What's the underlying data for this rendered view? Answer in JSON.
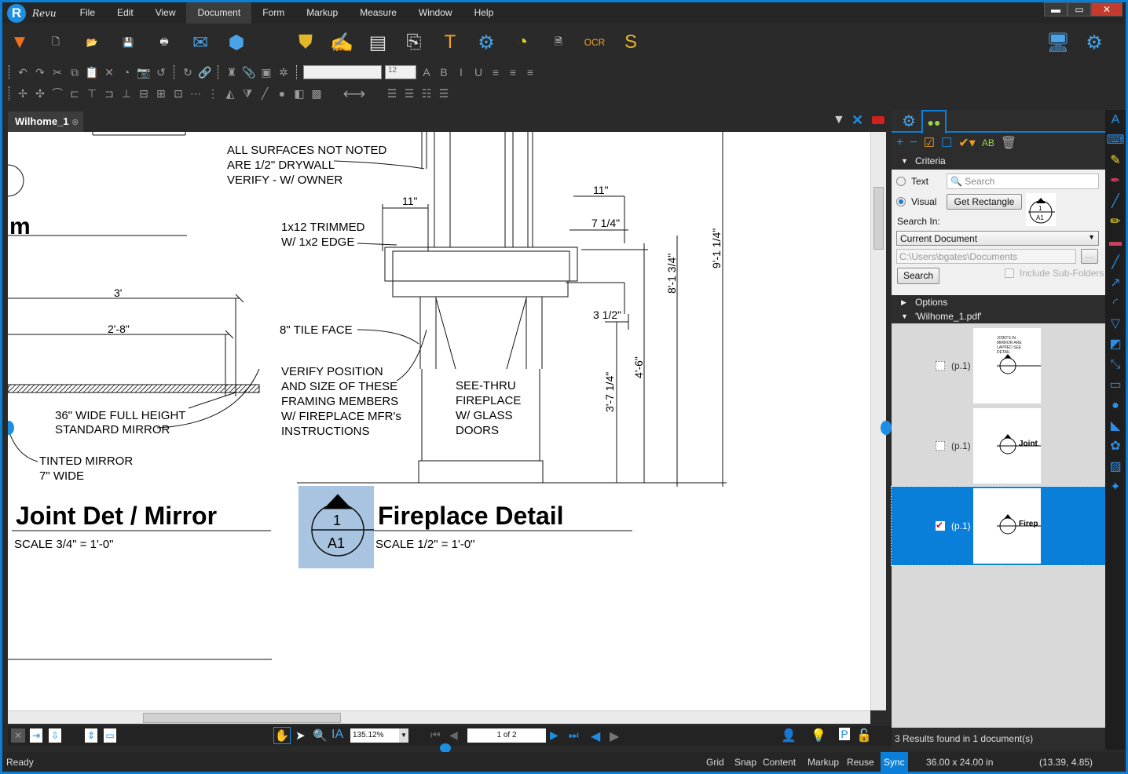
{
  "app": {
    "name": "Revu",
    "logo_letter": "R"
  },
  "menu": [
    "File",
    "Edit",
    "View",
    "Document",
    "Form",
    "Markup",
    "Measure",
    "Window",
    "Help"
  ],
  "menu_active": "Document",
  "window_controls": {
    "minimize": "▬",
    "restore": "▭",
    "close": "✕"
  },
  "toolbar_main": [
    {
      "name": "dropdown-arrow-icon",
      "glyph": "▼",
      "color": "#f07020"
    },
    {
      "name": "new-document-icon",
      "glyph": "🗋",
      "color": "#fff"
    },
    {
      "name": "open-folder-icon",
      "glyph": "📂",
      "color": "#b8864b"
    },
    {
      "name": "save-icon",
      "glyph": "💾",
      "color": "#888"
    },
    {
      "name": "print-icon",
      "glyph": "🖶",
      "color": "#eee"
    },
    {
      "name": "email-icon",
      "glyph": "✉",
      "color": "#4aa3e8"
    },
    {
      "name": "studio-icon",
      "glyph": "⬢",
      "color": "#4aa3e8"
    },
    {
      "name": "security-shield-icon",
      "glyph": "⛊",
      "color": "#e5b52a"
    },
    {
      "name": "signature-icon",
      "glyph": "✍",
      "color": "#4aa3e8"
    },
    {
      "name": "pages-icon",
      "glyph": "▤",
      "color": "#ddd"
    },
    {
      "name": "batch-icon",
      "glyph": "⎘",
      "color": "#ddd"
    },
    {
      "name": "text-search-icon",
      "glyph": "T",
      "color": "#f0a020"
    },
    {
      "name": "settings-gears-icon",
      "glyph": "⚙",
      "color": "#4aa3e8"
    },
    {
      "name": "measure-tape-icon",
      "glyph": "◔",
      "color": "#e5d32a"
    },
    {
      "name": "document-settings-icon",
      "glyph": "🗎",
      "color": "#fff"
    },
    {
      "name": "ocr-icon",
      "glyph": "OCR",
      "color": "#f0a020"
    },
    {
      "name": "sets-icon",
      "glyph": "S",
      "color": "#e5b52a"
    }
  ],
  "toolbar_right": [
    {
      "name": "monitor-icon",
      "glyph": "🖥",
      "color": "#4aa3e8"
    },
    {
      "name": "gear-icon",
      "glyph": "⚙",
      "color": "#4aa3e8"
    }
  ],
  "toolbar2_left": [
    "undo-icon",
    "redo-icon",
    "cut-icon",
    "copy-icon",
    "paste-icon",
    "delete-icon",
    "tape-icon",
    "snapshot-icon",
    "rotate-left-icon",
    "rotate-right-icon",
    "hyperlink-icon",
    "stamp-icon",
    "attachment-icon",
    "eraser-icon",
    "crop-icon"
  ],
  "toolbar2_glyphs": [
    "↶",
    "↷",
    "✂",
    "⧉",
    "📋",
    "✕",
    "◔",
    "📷",
    "↺",
    "↻",
    "🔗",
    "♜",
    "📎",
    "▣",
    "✲"
  ],
  "font_size": "12",
  "toolbar2_right": [
    {
      "name": "font-color-icon",
      "glyph": "A"
    },
    {
      "name": "bold-icon",
      "glyph": "B"
    },
    {
      "name": "italic-icon",
      "glyph": "I"
    },
    {
      "name": "underline-icon",
      "glyph": "U"
    },
    {
      "name": "align-left-icon",
      "glyph": "≡"
    },
    {
      "name": "align-center-icon",
      "glyph": "≡"
    },
    {
      "name": "align-right-icon",
      "glyph": "≡"
    }
  ],
  "toolbar3": [
    {
      "name": "add-vertex-icon",
      "glyph": "✢"
    },
    {
      "name": "remove-vertex-icon",
      "glyph": "✣"
    },
    {
      "name": "bezier-icon",
      "glyph": "⌒"
    },
    {
      "name": "align-left-edges-icon",
      "glyph": "⊏"
    },
    {
      "name": "align-top-icon",
      "glyph": "⊤"
    },
    {
      "name": "align-right-edges-icon",
      "glyph": "⊐"
    },
    {
      "name": "align-bottom-icon",
      "glyph": "⊥"
    },
    {
      "name": "center-horizontal-icon",
      "glyph": "⊟"
    },
    {
      "name": "center-vertical-icon",
      "glyph": "⊞"
    },
    {
      "name": "center-both-icon",
      "glyph": "⊡"
    },
    {
      "name": "distribute-horizontal-icon",
      "glyph": "⋯"
    },
    {
      "name": "distribute-vertical-icon",
      "glyph": "⋮"
    },
    {
      "name": "flip-horizontal-icon",
      "glyph": "◭"
    },
    {
      "name": "flip-vertical-icon",
      "glyph": "⧩"
    },
    {
      "name": "line-color-icon",
      "glyph": "╱"
    },
    {
      "name": "fill-color-icon",
      "glyph": "●"
    },
    {
      "name": "opacity-icon",
      "glyph": "◧"
    },
    {
      "name": "hatch-icon",
      "glyph": "▩"
    },
    {
      "name": "line-arrow-icon",
      "glyph": "⟷"
    },
    {
      "name": "line-style-icon",
      "glyph": "☰"
    },
    {
      "name": "line-width-icon",
      "glyph": "☰"
    },
    {
      "name": "dash-style-icon",
      "glyph": "☷"
    },
    {
      "name": "list-icon",
      "glyph": "☰"
    }
  ],
  "document_tab": {
    "label": "Wilhome_1",
    "close": "⊗"
  },
  "drawing": {
    "left_texts": [
      "m",
      "3'",
      "2'-8\"",
      "36\" WIDE FULL HEIGHT",
      "STANDARD MIRROR",
      "TINTED MIRROR",
      "7\" WIDE"
    ],
    "left_title": "Joint Det / Mirror",
    "left_scale": "SCALE  3/4\" =  1'-0\"",
    "notes": [
      "ALL SURFACES NOT NOTED",
      "ARE 1/2\" DRYWALL",
      "VERIFY - W/ OWNER",
      "1x12 TRIMMED",
      "W/ 1x2 EDGE",
      "8\" TILE FACE",
      "VERIFY POSITION",
      "AND SIZE OF THESE",
      "FRAMING MEMBERS",
      "W/ FIREPLACE MFR's",
      "INSTRUCTIONS",
      "SEE-THRU",
      "FIREPLACE",
      "W/ GLASS",
      "DOORS"
    ],
    "dims": [
      "11\"",
      "11\"",
      "7 1/4\"",
      "3 1/2\"",
      "8'-1 3/4\"",
      "9'-1 1/4\"",
      "4'-6\"",
      "3'-7 1/4\""
    ],
    "marker": {
      "number": "1",
      "sheet": "A1"
    },
    "right_title": "Fireplace Detail",
    "right_scale": "SCALE  1/2\" =  1'-0\""
  },
  "bottom_toolbar": {
    "zoom": "135.12%",
    "page": "1 of 2"
  },
  "status": {
    "ready": "Ready",
    "toggles": [
      "Grid",
      "Snap",
      "Content",
      "Markup",
      "Reuse",
      "Sync"
    ],
    "active_toggle": "Sync",
    "size": "36.00 x 24.00 in",
    "coords": "(13.39, 4.85)"
  },
  "panel": {
    "criteria_label": "Criteria",
    "text_option": "Text",
    "visual_option": "Visual",
    "selected_option": "Visual",
    "search_placeholder": "Search",
    "get_rectangle": "Get Rectangle",
    "search_in_label": "Search In:",
    "search_in_value": "Current Document",
    "path_value": "C:\\Users\\bgates\\Documents",
    "browse": "...",
    "search_button": "Search",
    "include_subfolders": "Include Sub-Folders",
    "options_label": "Options",
    "file_label": "'Wilhome_1.pdf'",
    "results": [
      {
        "label": "(p.1)",
        "checked": false,
        "thumb": "JOINTS IN MIRROR ARE LAPPED SEE DETAIL"
      },
      {
        "label": "(p.1)",
        "checked": false,
        "thumb": "Joint"
      },
      {
        "label": "(p.1)",
        "checked": true,
        "thumb": "Firep"
      }
    ],
    "footer": "3 Results found in 1 document(s)"
  },
  "right_tools": [
    "text-box-icon",
    "typewriter-icon",
    "note-icon",
    "highlight-pen-icon",
    "pen-icon",
    "highlighter-icon",
    "eraser-icon",
    "line-icon",
    "arrow-icon",
    "arc-icon",
    "polygon-icon",
    "callout-icon",
    "dimension-icon",
    "rectangle-icon",
    "ellipse-icon",
    "polygon-shape-icon",
    "cloud-icon",
    "image-icon",
    "stamp-icon"
  ],
  "colors": {
    "accent": "#0a7fd9",
    "chrome": "#2a2a2a",
    "marker_bg": "#a8c4e0"
  }
}
